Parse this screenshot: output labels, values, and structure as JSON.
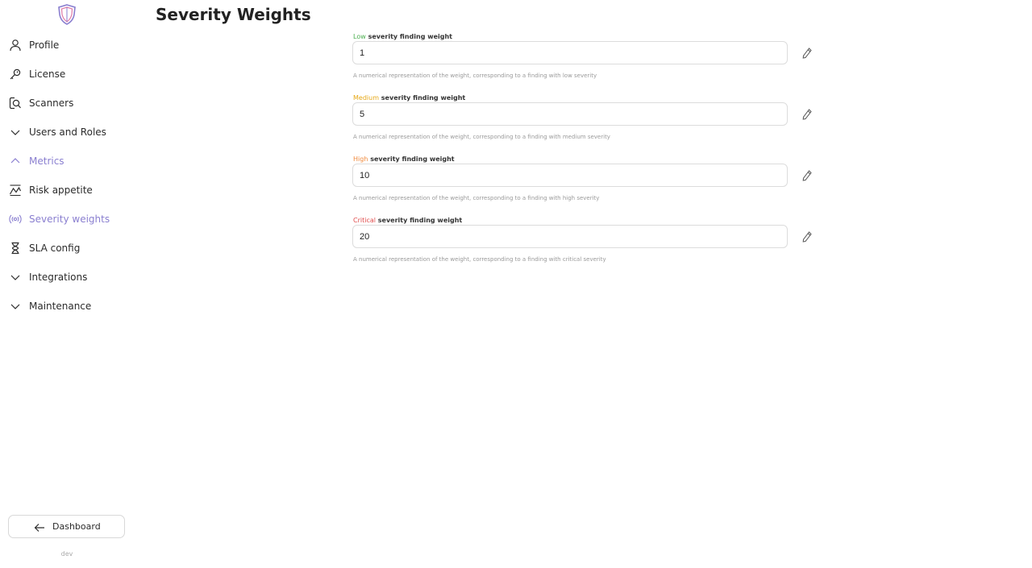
{
  "page": {
    "title": "Severity Weights"
  },
  "sidebar": {
    "items": [
      {
        "label": "Profile",
        "icon": "user-icon",
        "active": false
      },
      {
        "label": "License",
        "icon": "key-icon",
        "active": false
      },
      {
        "label": "Scanners",
        "icon": "scan-search-icon",
        "active": false
      },
      {
        "label": "Users and Roles",
        "icon": "chevron-down-icon",
        "active": false
      },
      {
        "label": "Metrics",
        "icon": "chevron-up-icon",
        "active": true
      },
      {
        "label": "Risk appetite",
        "icon": "trend-chart-icon",
        "active": false
      },
      {
        "label": "Severity weights",
        "icon": "radio-waves-icon",
        "active": true
      },
      {
        "label": "SLA config",
        "icon": "hourglass-icon",
        "active": false
      },
      {
        "label": "Integrations",
        "icon": "chevron-down-icon",
        "active": false
      },
      {
        "label": "Maintenance",
        "icon": "chevron-down-icon",
        "active": false
      }
    ],
    "dashboard_button": "Dashboard",
    "env_label": "dev"
  },
  "weights": [
    {
      "severity": "Low",
      "label_suffix": "severity finding weight",
      "value": "1",
      "help": "A numerical representation of the weight, corresponding to a finding with low severity",
      "color": "#4caf50"
    },
    {
      "severity": "Medium",
      "label_suffix": "severity finding weight",
      "value": "5",
      "help": "A numerical representation of the weight, corresponding to a finding with medium severity",
      "color": "#e6a817"
    },
    {
      "severity": "High",
      "label_suffix": "severity finding weight",
      "value": "10",
      "help": "A numerical representation of the weight, corresponding to a finding with high severity",
      "color": "#f08a3c"
    },
    {
      "severity": "Critical",
      "label_suffix": "severity finding weight",
      "value": "20",
      "help": "A numerical representation of the weight, corresponding to a finding with critical severity",
      "color": "#e04b4b"
    }
  ],
  "colors": {
    "accent": "#8a7fd0",
    "text": "#2b2b2b",
    "border": "#dcdcdc",
    "muted": "#9a9a9a"
  }
}
